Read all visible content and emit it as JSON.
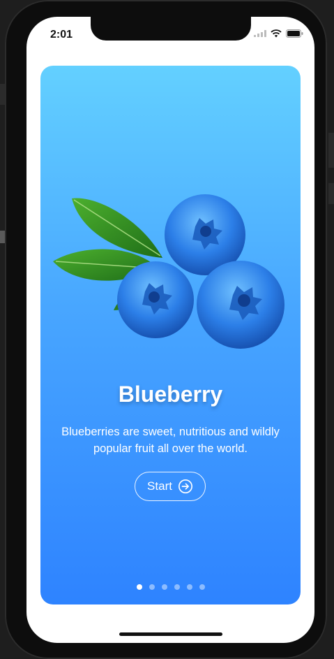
{
  "status": {
    "time": "2:01"
  },
  "card": {
    "title": "Blueberry",
    "description": "Blueberries are sweet, nutritious and wildly popular fruit all over the world.",
    "start_label": "Start",
    "start_icon": "arrow-right-circle-icon",
    "image_icon": "blueberry-icon",
    "page_count": 6,
    "active_page": 1
  },
  "colors": {
    "gradient_top": "#63d0ff",
    "gradient_bottom": "#2e83ff",
    "berry": "#2b7fe6",
    "leaf": "#2e8b22"
  }
}
